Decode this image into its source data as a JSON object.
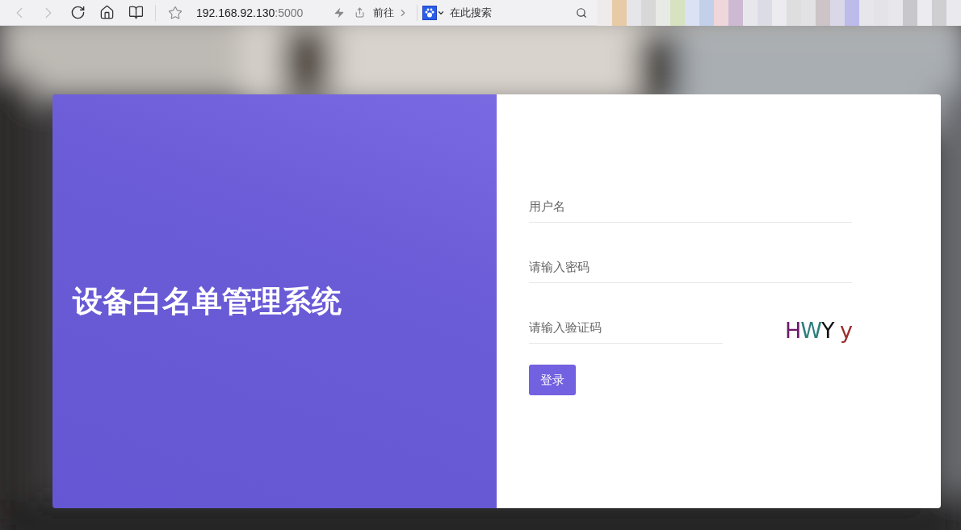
{
  "browser": {
    "nav": [
      {
        "kind": "back",
        "disabled": true
      },
      {
        "kind": "forward",
        "disabled": true
      },
      {
        "kind": "reload",
        "disabled": false
      },
      {
        "kind": "home",
        "disabled": false
      },
      {
        "kind": "reader",
        "disabled": false
      }
    ],
    "address": {
      "host": "192.168.92.130",
      "port": ":5000"
    },
    "go_label": "前往",
    "search_placeholder": "在此搜索"
  },
  "login": {
    "title": "设备白名单管理系统",
    "fields": [
      {
        "kind": "text",
        "placeholder": "用户名"
      },
      {
        "kind": "password",
        "placeholder": "请输入密码"
      },
      {
        "kind": "captcha",
        "placeholder": "请输入验证码"
      }
    ],
    "captcha": [
      {
        "text": "H",
        "color": "#6b1a6b"
      },
      {
        "text": "W",
        "color": "#2e7d7d"
      },
      {
        "text": "Y",
        "color": "#111111"
      },
      {
        "text": " y",
        "color": "#9b2c2c"
      }
    ],
    "submit": "登录"
  }
}
